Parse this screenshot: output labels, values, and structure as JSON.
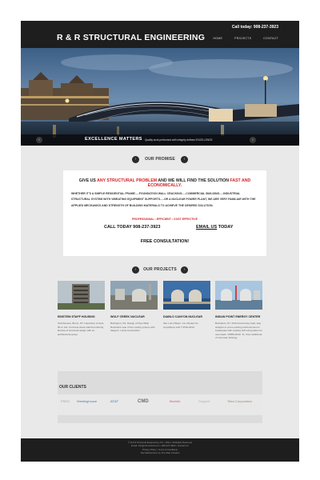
{
  "header": {
    "logo": "R & R STRUCTURAL ENGINEERING",
    "call": "Call today: 908-237-3923",
    "nav": [
      "HOME",
      "PROJECTS",
      "CONTACT"
    ]
  },
  "hero": {
    "title": "EXCELLENCE MATTERS",
    "subtitle": "Quality work performed with integrity defines EXCELLENCE",
    "prev": "‹",
    "next": "›"
  },
  "promise": {
    "heading": "OUR PROMISE",
    "head_pre": "GIVE US ",
    "head_red1": "ANY STRUCTURAL PROBLEM",
    "head_mid": " AND WE WILL FIND THE SOLUTION ",
    "head_red2": "FAST AND ECONOMICALLY.",
    "body": "WHETHER IT'S A SIMPLE RESIDENTIAL FRAME.....FOUNDATION WALL CRACKING.....COMMERCIAL BUILDING.....INDUSTRIAL STRUCTURAL SYSTEM WITH VIBRATING EQUIPMENT SUPPORTS.....OR A NUCLEAR POWER PLANT, WE ARE VERY FAMILIAR WITH THE APPLIED MECHANICS AND STRENGTH OF BUILDING MATERIALS TO ACHIEVE THE DESIRED SOLUTION.",
    "tagline": "PROFESSIONAL • EFFICIENT • COST EFFECTIVE",
    "call": "CALL TODAY 908-237-3923",
    "email_link": "EMAIL US",
    "email_suffix": " TODAY",
    "free": "FREE CONSULTATION!"
  },
  "projects": {
    "heading": "OUR PROJECTS",
    "items": [
      {
        "title": "EINSTEIN STAFF HOUSING",
        "text": "Townhouses, Bronx, NY. Inspection of slow-fill on site. Concrete shear wall and shoring. Review of structural design with an architectural group."
      },
      {
        "title": "WOLF CREEK NUCLEAR",
        "text": "Burlington, KS. Design of Pipe Whip Restraints near of the cooling system with Sargent. Lundy Corporation."
      },
      {
        "title": "DIABLO CANYON NUCLEAR",
        "text": "San Luis Obispo, CA. Review for compliance with T-PCE-2010."
      },
      {
        "title": "INDIAN POINT ENERGY CENTER",
        "text": "Buchanan, NY. Performed heavy load, stay analysis to prove existing reinforcement is inadequate with existing stiff ening plates for new loads. VWBS-2010. To. Over additional of new load, Entergy."
      }
    ]
  },
  "clients": {
    "heading": "OUR CLIENTS",
    "logos": [
      "PSEG",
      "Westinghouse",
      "AT&T",
      "CMD",
      "Bechtel",
      "Sargent",
      "Tetra Corporation"
    ]
  },
  "footer": {
    "lines": [
      "© R & R Structural Engineering, PC • 2014 • All Rights Reserved",
      "Email: info@rrstructural.com • 908-237-3923 • Contact Us",
      "Privacy Policy • Terms & Conditions",
      "Site Maintenance by The Web Creators"
    ]
  },
  "colors": {
    "accent_red": "#d21f26",
    "header_bg": "#1e1e1e",
    "page_bg": "#e9e9e9"
  }
}
